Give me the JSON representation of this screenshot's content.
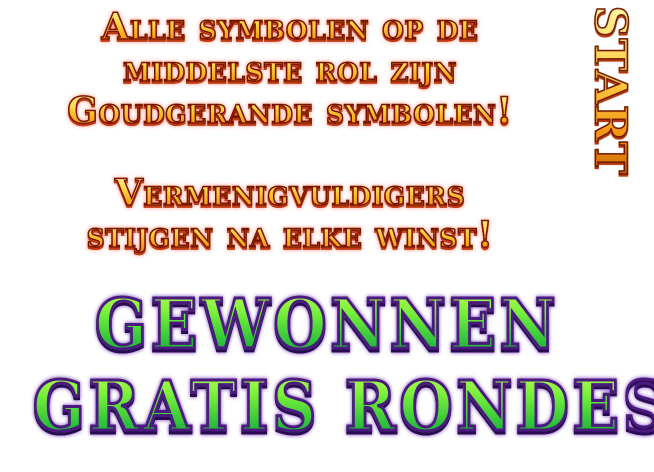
{
  "intro": {
    "line1": "Alle symbolen op de",
    "line2": "middelste rol zijn",
    "line3": "Goudgerande symbolen!",
    "line4": "Vermenigvuldigers",
    "line5": "stijgen na elke winst!"
  },
  "start_button": {
    "label": "START"
  },
  "title": {
    "line1": "GEWONNEN",
    "line2": "GRATIS RONDES"
  },
  "colors": {
    "gold_top": "#fff6a8",
    "gold_bottom": "#e07a0a",
    "gold_outline": "#7a1200",
    "green_top": "#c8ff5a",
    "green_bottom": "#12963a",
    "green_outline": "#4a1a7e"
  }
}
